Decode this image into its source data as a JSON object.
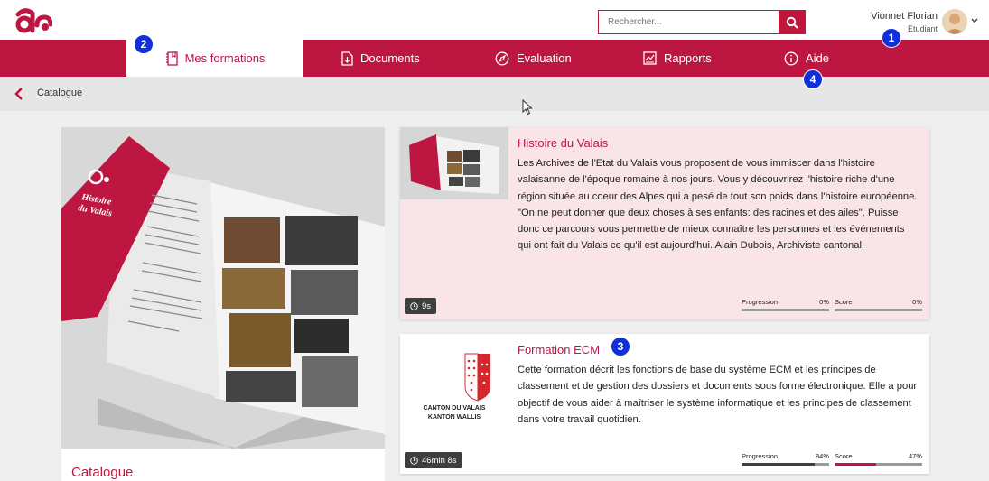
{
  "colors": {
    "brand": "#bd1641",
    "badge": "#1230d8"
  },
  "header": {
    "logo_icon": "app-logo",
    "search": {
      "placeholder": "Rechercher..."
    },
    "user": {
      "name": "Vionnet Florian",
      "role": "Etudiant"
    }
  },
  "nav": {
    "tabs": [
      {
        "label": "Mes formations",
        "icon": "book-icon",
        "active": true
      },
      {
        "label": "Documents",
        "icon": "document-icon",
        "active": false
      },
      {
        "label": "Evaluation",
        "icon": "compass-icon",
        "active": false
      },
      {
        "label": "Rapports",
        "icon": "report-icon",
        "active": false
      },
      {
        "label": "Aide",
        "icon": "info-icon",
        "active": false
      }
    ]
  },
  "breadcrumb": {
    "label": "Catalogue"
  },
  "annotations": [
    "1",
    "2",
    "3",
    "4"
  ],
  "catalog": {
    "title": "Catalogue",
    "cover_title": "Histoire du Valais"
  },
  "courses": [
    {
      "title": "Histoire du Valais",
      "description": "Les Archives de l'Etat du Valais vous proposent de vous immiscer dans l'histoire valaisanne de l'époque romaine à nos jours. Vous y découvrirez l'histoire riche d'une région située au coeur des Alpes qui a pesé de tout son poids dans l'histoire européenne. \"On ne peut donner que deux choses à ses enfants: des racines et des ailes\". Puisse donc ce parcours vous permettre de mieux connaître les personnes et les événements qui ont fait du Valais ce qu'il est aujourd'hui. Alain Dubois, Archiviste cantonal.",
      "duration": "9s",
      "progression_label": "Progression",
      "progression": "0%",
      "progression_value": 0,
      "score_label": "Score",
      "score": "0%",
      "score_value": 0
    },
    {
      "title": "Formation ECM",
      "description": "Cette formation décrit les fonctions de base du système ECM et les principes de classement et de gestion des dossiers et documents sous forme électronique. Elle a pour objectif de vous aider à maîtriser le système informatique et les principes de classement dans votre travail quotidien.",
      "duration": "46min 8s",
      "thumb_caption_1": "CANTON DU VALAIS",
      "thumb_caption_2": "KANTON WALLIS",
      "progression_label": "Progression",
      "progression": "84%",
      "progression_value": 84,
      "score_label": "Score",
      "score": "47%",
      "score_value": 47
    }
  ]
}
